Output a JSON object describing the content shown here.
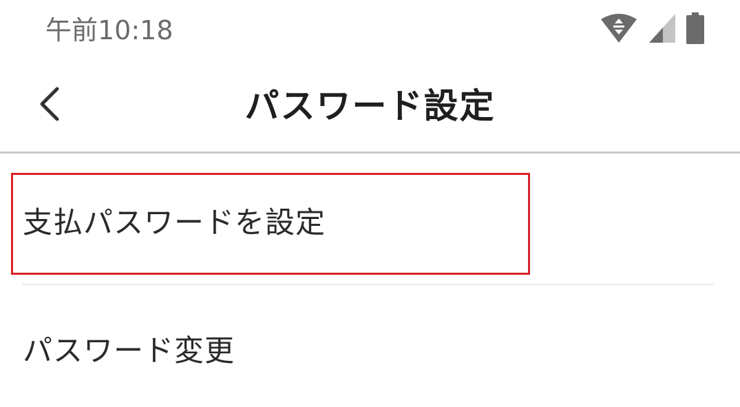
{
  "status_bar": {
    "time": "午前10:18",
    "icons": [
      "wifi-icon",
      "cellular-signal-icon",
      "battery-icon"
    ]
  },
  "app_bar": {
    "back_icon": "chevron-left-icon",
    "title": "パスワード設定"
  },
  "list": {
    "items": [
      {
        "label": "支払パスワードを設定",
        "highlighted": true
      },
      {
        "label": "パスワード変更",
        "highlighted": false
      }
    ]
  },
  "colors": {
    "highlight": "#d8232a",
    "divider": "#ececec",
    "app_bar_border": "#c8c8c8",
    "status_text": "#6b6b6b"
  }
}
